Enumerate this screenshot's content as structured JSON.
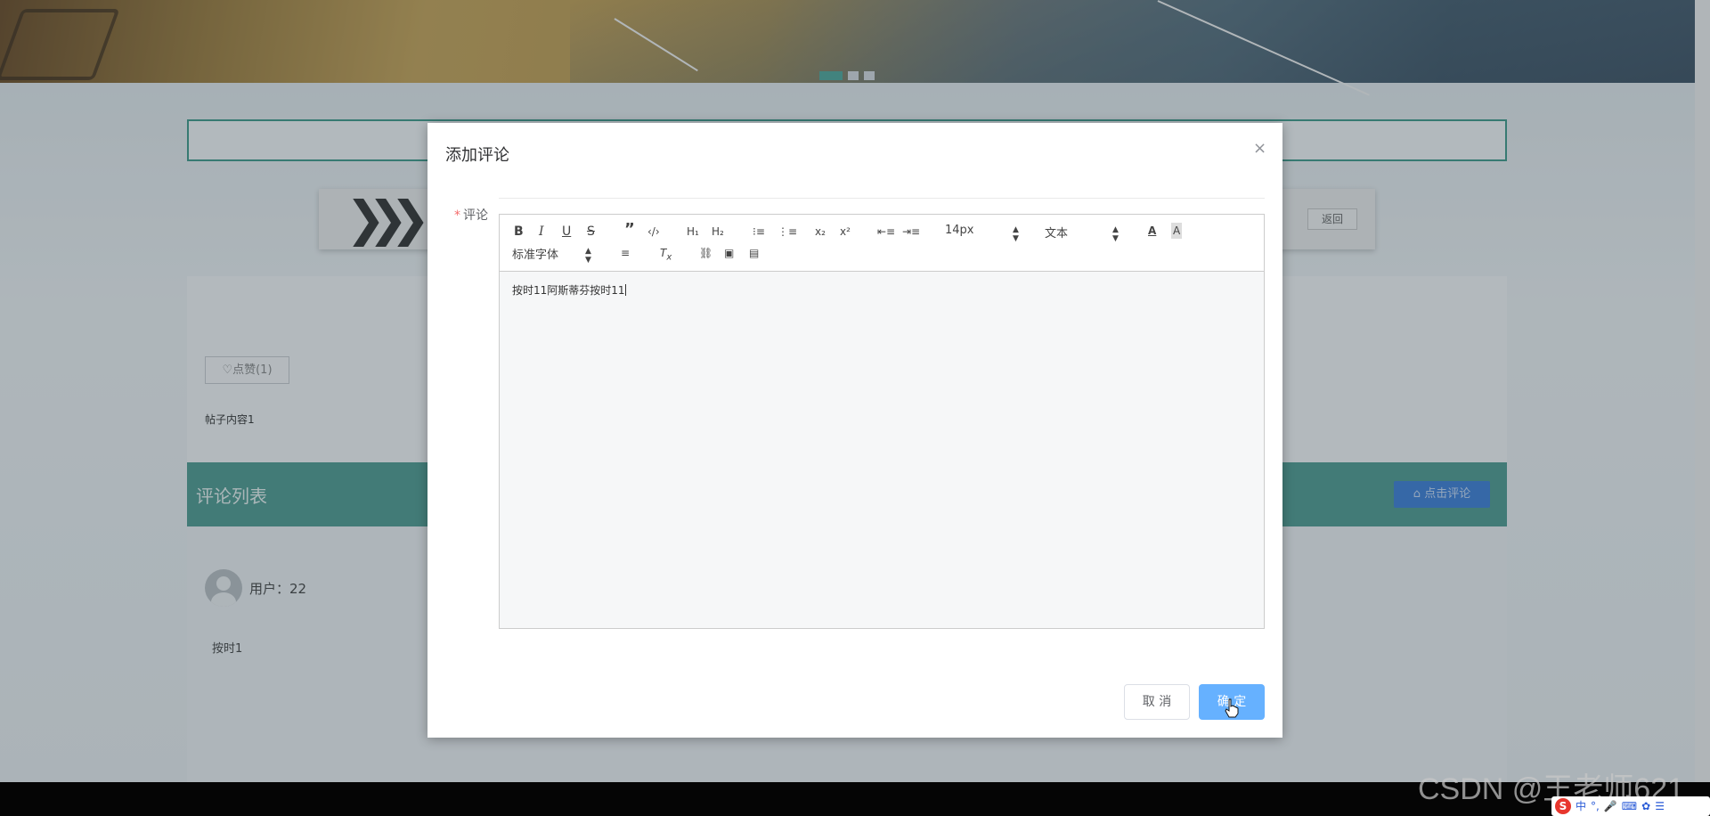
{
  "carousel": {
    "dots": 3,
    "active_index": 0
  },
  "post": {
    "back_label": "返回",
    "like_label": "♡点赞(1)",
    "content": "帖子内容1"
  },
  "comments": {
    "title": "评论列表",
    "add_label": "点击评论",
    "items": [
      {
        "user": "用户：22",
        "text": "按时1"
      }
    ]
  },
  "dialog": {
    "title": "添加评论",
    "close_glyph": "×",
    "field_label": "评论",
    "required_mark": "*",
    "editor": {
      "font_size": "14px",
      "block_format": "文本",
      "font_family": "标准字体",
      "content": "按时11阿斯蒂芬按时11"
    },
    "cancel_label": "取 消",
    "confirm_label": "确 定"
  },
  "watermark": "CSDN @王老师621",
  "ime": {
    "logo": "S",
    "mode": "中",
    "punct": "°,"
  },
  "colors": {
    "accent": "#4e9b91",
    "primary": "#66b1ff",
    "danger": "#f56c6c"
  }
}
